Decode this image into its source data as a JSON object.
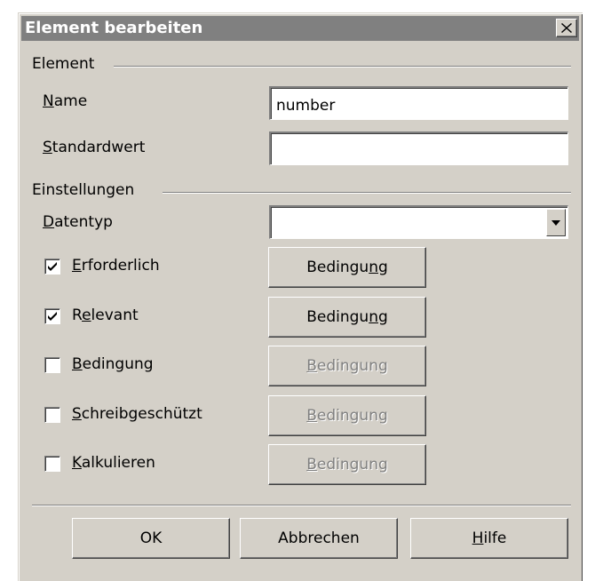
{
  "window": {
    "title": "Element bearbeiten",
    "close_glyph": "✕"
  },
  "element_section": {
    "label": "Element",
    "name": {
      "mnemonic": "N",
      "rest": "ame",
      "value": "number"
    },
    "default_value": {
      "mnemonic": "S",
      "rest": "tandardwert",
      "value": ""
    }
  },
  "settings_section": {
    "label": "Einstellungen",
    "datatype": {
      "mnemonic": "D",
      "rest": "atentyp",
      "selected": ""
    },
    "options": [
      {
        "pre": "",
        "mnemonic": "E",
        "rest": "rforderlich",
        "checked": true,
        "button": {
          "pre": "Bedingu",
          "mnemonic": "n",
          "rest": "g",
          "enabled": true
        }
      },
      {
        "pre": "R",
        "mnemonic": "e",
        "rest": "levant",
        "checked": true,
        "button": {
          "pre": "Bedingu",
          "mnemonic": "n",
          "rest": "g",
          "enabled": true
        }
      },
      {
        "pre": "",
        "mnemonic": "B",
        "rest": "edingung",
        "checked": false,
        "button": {
          "pre": "",
          "mnemonic": "B",
          "rest": "edingung",
          "enabled": false
        }
      },
      {
        "pre": "",
        "mnemonic": "S",
        "rest": "chreibgeschützt",
        "checked": false,
        "button": {
          "pre": "",
          "mnemonic": "B",
          "rest": "edingung",
          "enabled": false
        }
      },
      {
        "pre": "",
        "mnemonic": "K",
        "rest": "alkulieren",
        "checked": false,
        "button": {
          "pre": "",
          "mnemonic": "B",
          "rest": "edingung",
          "enabled": false
        }
      }
    ]
  },
  "footer": {
    "ok": "OK",
    "cancel": "Abbrechen",
    "help": {
      "mnemonic": "H",
      "rest": "ilfe"
    }
  },
  "colors": {
    "face": "#d4d0c8",
    "titlebar": "#808080",
    "disabled_text": "#808080"
  }
}
